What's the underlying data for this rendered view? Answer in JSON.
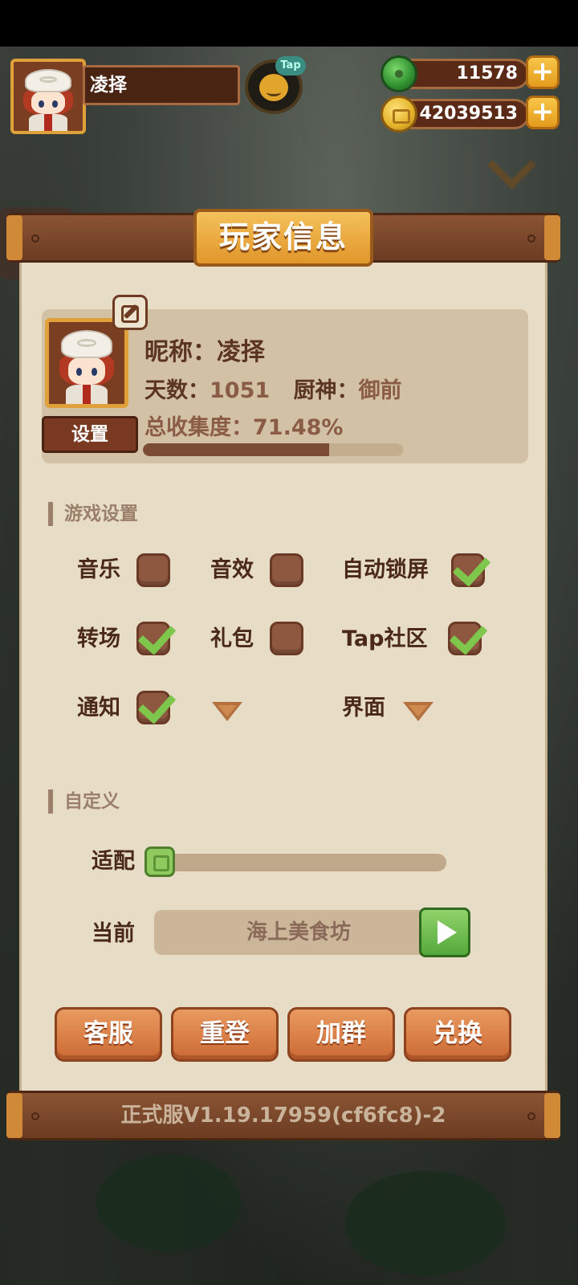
{
  "player": {
    "name": "凌择",
    "nickname_label": "昵称：",
    "days_label": "天数：",
    "days": "1051",
    "chef_label": "厨神：",
    "chef": "御前",
    "collection_label": "总收集度：",
    "collection_text": "71.48%",
    "collection_fraction": 0.7148
  },
  "resources": {
    "jade": "11578",
    "gold": "42039513"
  },
  "hud": {
    "tap_badge": "Tap"
  },
  "panel": {
    "title": "玩家信息",
    "setup_button": "设置"
  },
  "game_settings": {
    "header": "游戏设置",
    "options": {
      "music": {
        "label": "音乐",
        "checked": false
      },
      "sfx": {
        "label": "音效",
        "checked": false
      },
      "auto_lock": {
        "label": "自动锁屏",
        "checked": true
      },
      "transition": {
        "label": "转场",
        "checked": true
      },
      "gift": {
        "label": "礼包",
        "checked": false
      },
      "tap_community": {
        "label": "Tap社区",
        "checked": true
      },
      "notify": {
        "label": "通知",
        "checked": true
      },
      "ui": {
        "label": "界面"
      }
    }
  },
  "custom": {
    "header": "自定义",
    "fit_label": "适配",
    "fit_value": 0,
    "current_label": "当前",
    "current_scene": "海上美食坊"
  },
  "actions": {
    "service": "客服",
    "relogin": "重登",
    "join_group": "加群",
    "redeem": "兑换"
  },
  "version": "正式服V1.19.17959(cf6fc8)-2",
  "colors": {
    "check_green": "#7fc64d",
    "action_orange": "#e0844a",
    "paper": "#e7dcc6"
  }
}
